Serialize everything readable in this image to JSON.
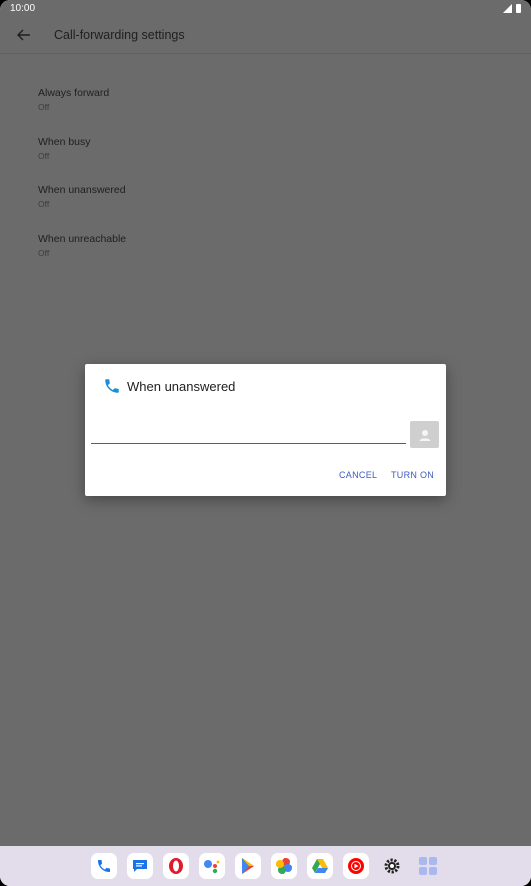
{
  "status_bar": {
    "time": "10:00"
  },
  "app_bar": {
    "title": "Call-forwarding settings",
    "back_icon": "arrow-back-icon"
  },
  "preferences": [
    {
      "title": "Always forward",
      "summary": "Off"
    },
    {
      "title": "When busy",
      "summary": "Off"
    },
    {
      "title": "When unanswered",
      "summary": "Off"
    },
    {
      "title": "When unreachable",
      "summary": "Off"
    }
  ],
  "dialog": {
    "title": "When unanswered",
    "icon": "phone-icon",
    "input_value": "",
    "input_placeholder": "",
    "cancel_label": "CANCEL",
    "turn_on_label": "TURN ON"
  },
  "dock": {
    "apps": [
      "phone-app-icon",
      "messages-app-icon",
      "opera-app-icon",
      "assistant-app-icon",
      "play-store-app-icon",
      "photos-app-icon",
      "drive-app-icon",
      "youtube-music-app-icon",
      "settings-app-icon",
      "app-drawer-icon"
    ]
  },
  "colors": {
    "accent": "#3b5bbf",
    "phone_icon": "#1a8fd6",
    "scrim": "#6b6b6b"
  }
}
